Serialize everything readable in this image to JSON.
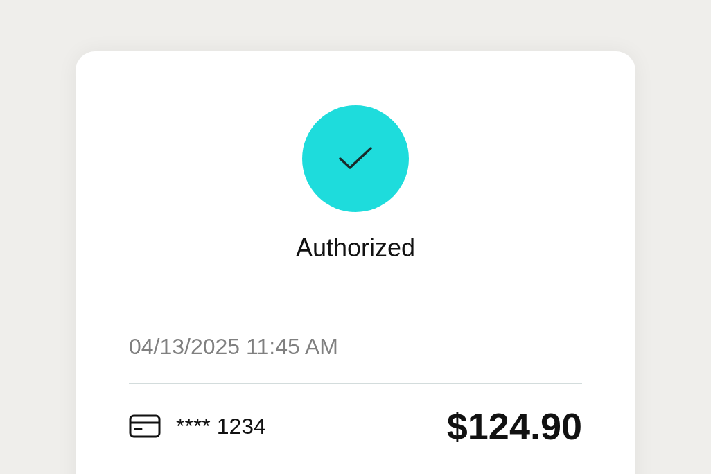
{
  "status": {
    "kind": "authorized",
    "label": "Authorized"
  },
  "transaction": {
    "datetime": "04/13/2025 11:45 AM",
    "card": "**** 1234",
    "amount": "$124.90"
  }
}
